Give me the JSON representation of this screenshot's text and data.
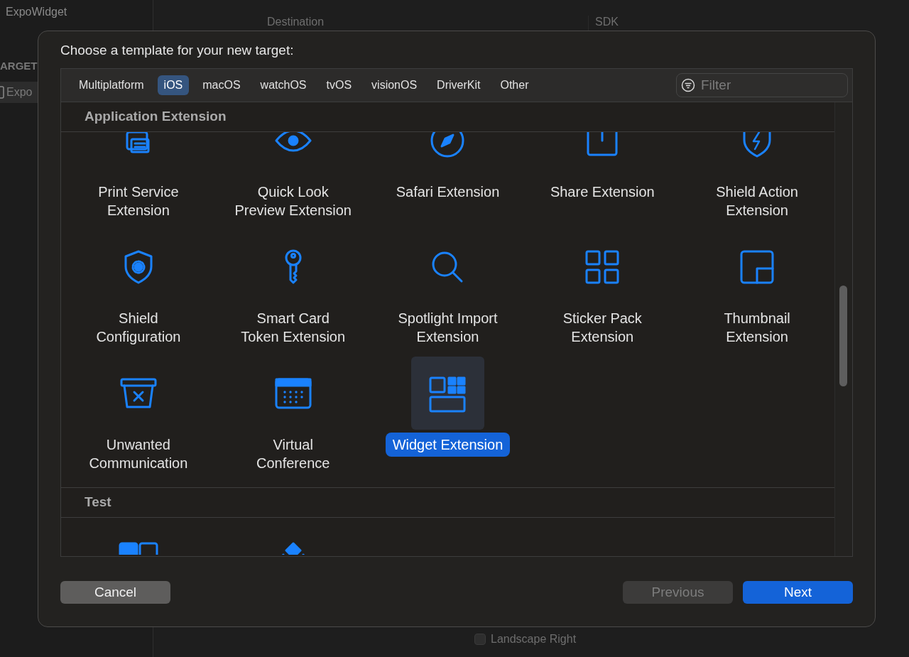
{
  "background": {
    "sidebar": {
      "project": "ExpoWidget",
      "section": "ARGET",
      "item": "Expo"
    },
    "columns": [
      "Destination",
      "SDK"
    ],
    "checkbox": {
      "label": "Landscape Right",
      "checked": false
    }
  },
  "dialog": {
    "title": "Choose a template for your new target:",
    "tabs": [
      {
        "label": "Multiplatform",
        "selected": false
      },
      {
        "label": "iOS",
        "selected": true
      },
      {
        "label": "macOS",
        "selected": false
      },
      {
        "label": "watchOS",
        "selected": false
      },
      {
        "label": "tvOS",
        "selected": false
      },
      {
        "label": "visionOS",
        "selected": false
      },
      {
        "label": "DriverKit",
        "selected": false
      },
      {
        "label": "Other",
        "selected": false
      }
    ],
    "filter": {
      "placeholder": "Filter"
    },
    "sections": [
      {
        "title": "Application Extension",
        "templates": [
          {
            "label": "Print Service\nExtension",
            "selected": false
          },
          {
            "label": "Quick Look\nPreview Extension",
            "selected": false
          },
          {
            "label": "Safari Extension",
            "selected": false
          },
          {
            "label": "Share Extension",
            "selected": false
          },
          {
            "label": "Shield Action\nExtension",
            "selected": false
          },
          {
            "label": "Shield\nConfiguration",
            "selected": false
          },
          {
            "label": "Smart Card\nToken Extension",
            "selected": false
          },
          {
            "label": "Spotlight Import\nExtension",
            "selected": false
          },
          {
            "label": "Sticker Pack\nExtension",
            "selected": false
          },
          {
            "label": "Thumbnail\nExtension",
            "selected": false
          },
          {
            "label": "Unwanted\nCommunication",
            "selected": false
          },
          {
            "label": "Virtual\nConference",
            "selected": false
          },
          {
            "label": "Widget Extension",
            "selected": true
          }
        ]
      },
      {
        "title": "Test",
        "templates": [
          {
            "selected": false
          },
          {
            "selected": false
          }
        ]
      }
    ],
    "buttons": [
      {
        "label": "Cancel",
        "kind": "secondary",
        "disabled": false
      },
      {
        "label": "Previous",
        "kind": "secondary",
        "disabled": true
      },
      {
        "label": "Next",
        "kind": "primary",
        "disabled": false
      }
    ]
  }
}
